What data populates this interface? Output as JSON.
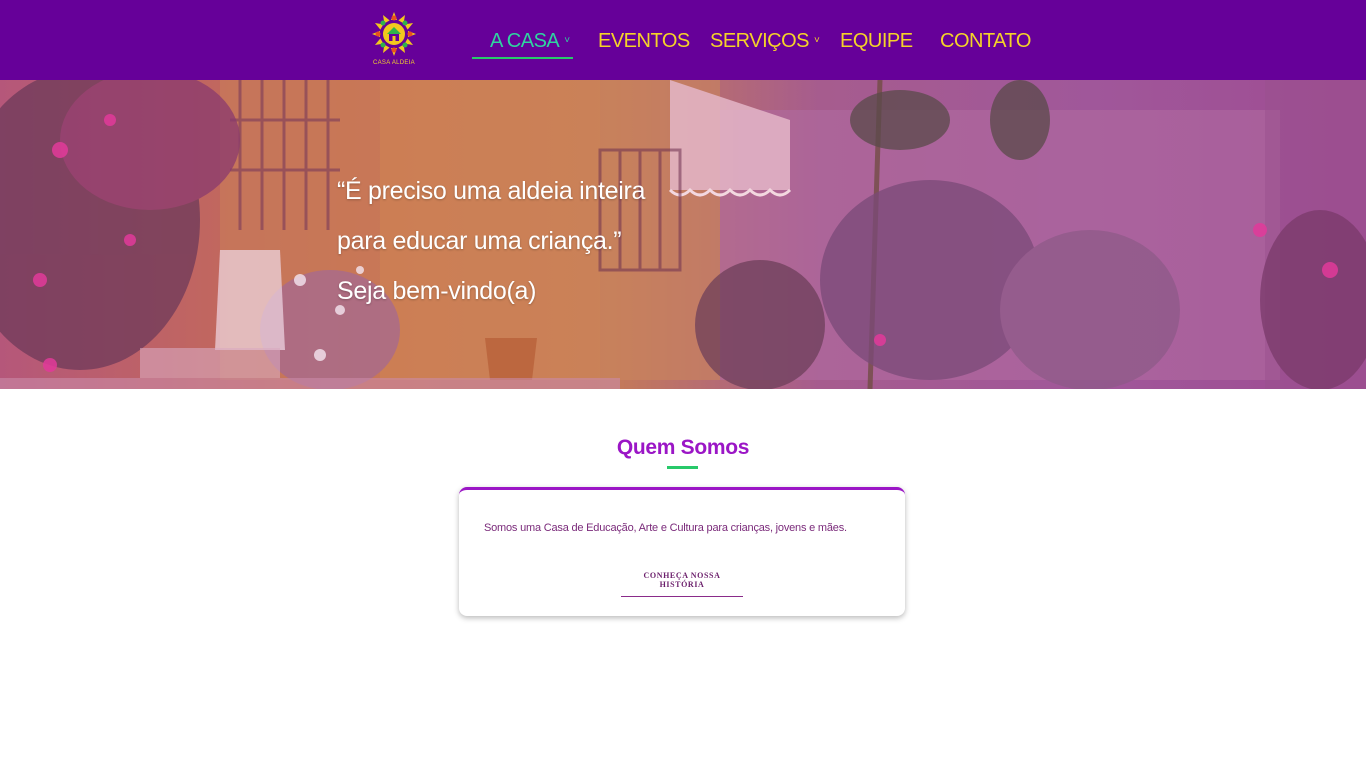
{
  "brand": {
    "logo_text": "CASA ALDEIA"
  },
  "nav": {
    "items": [
      {
        "label": "A CASA",
        "has_dropdown": true,
        "active": true
      },
      {
        "label": "EVENTOS",
        "has_dropdown": false,
        "active": false
      },
      {
        "label": "SERVIÇOS",
        "has_dropdown": true,
        "active": false
      },
      {
        "label": "EQUIPE",
        "has_dropdown": false,
        "active": false
      },
      {
        "label": "CONTATO",
        "has_dropdown": false,
        "active": false
      }
    ],
    "chevron": "˅"
  },
  "hero": {
    "quote_line1": "“É preciso uma aldeia inteira",
    "quote_line2": "para educar uma criança.”",
    "welcome": "Seja bem-vindo(a)"
  },
  "about": {
    "title": "Quem Somos",
    "description": "Somos uma Casa de Educação, Arte e Cultura para crianças, jovens e mães.",
    "link_label": "CONHEÇA NOSSA HISTÓRIA"
  },
  "colors": {
    "nav_bg": "#660099",
    "nav_text": "#f5d328",
    "nav_active": "#2fd4a0",
    "accent_green": "#28c96a",
    "title_purple": "#9b16c6"
  }
}
